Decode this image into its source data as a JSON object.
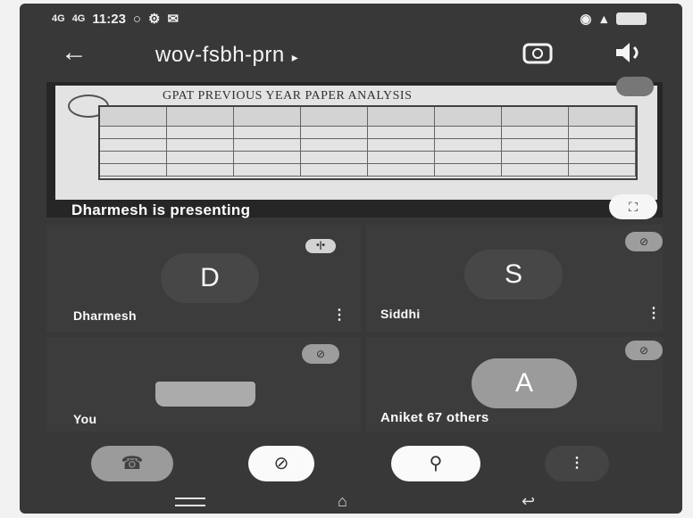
{
  "status": {
    "signal": "4G",
    "time": "11:23",
    "icons_left": [
      "circle-icon",
      "settings-icon",
      "message-icon"
    ],
    "icons_right": [
      "notification-icon",
      "signal-icon",
      "battery-icon"
    ]
  },
  "header": {
    "back_label": "←",
    "meeting_code": "wov-fsbh-prn",
    "caret": "▸"
  },
  "presentation": {
    "doc_title": "GPAT PREVIOUS YEAR PAPER ANALYSIS",
    "presenting_text": "Dharmesh is presenting",
    "fullscreen_glyph": "⛶"
  },
  "participants": [
    {
      "initial": "D",
      "name": "Dharmesh"
    },
    {
      "initial": "S",
      "name": "Siddhi"
    },
    {
      "initial": "",
      "name": "You"
    },
    {
      "initial": "A",
      "name": "Aniket   67 others"
    }
  ],
  "controls": {
    "end_call": "☎",
    "camera_off": "⊘",
    "mic_off": "⚲",
    "more": "⋮"
  },
  "nav": {
    "home": "⌂",
    "back": "↩"
  }
}
